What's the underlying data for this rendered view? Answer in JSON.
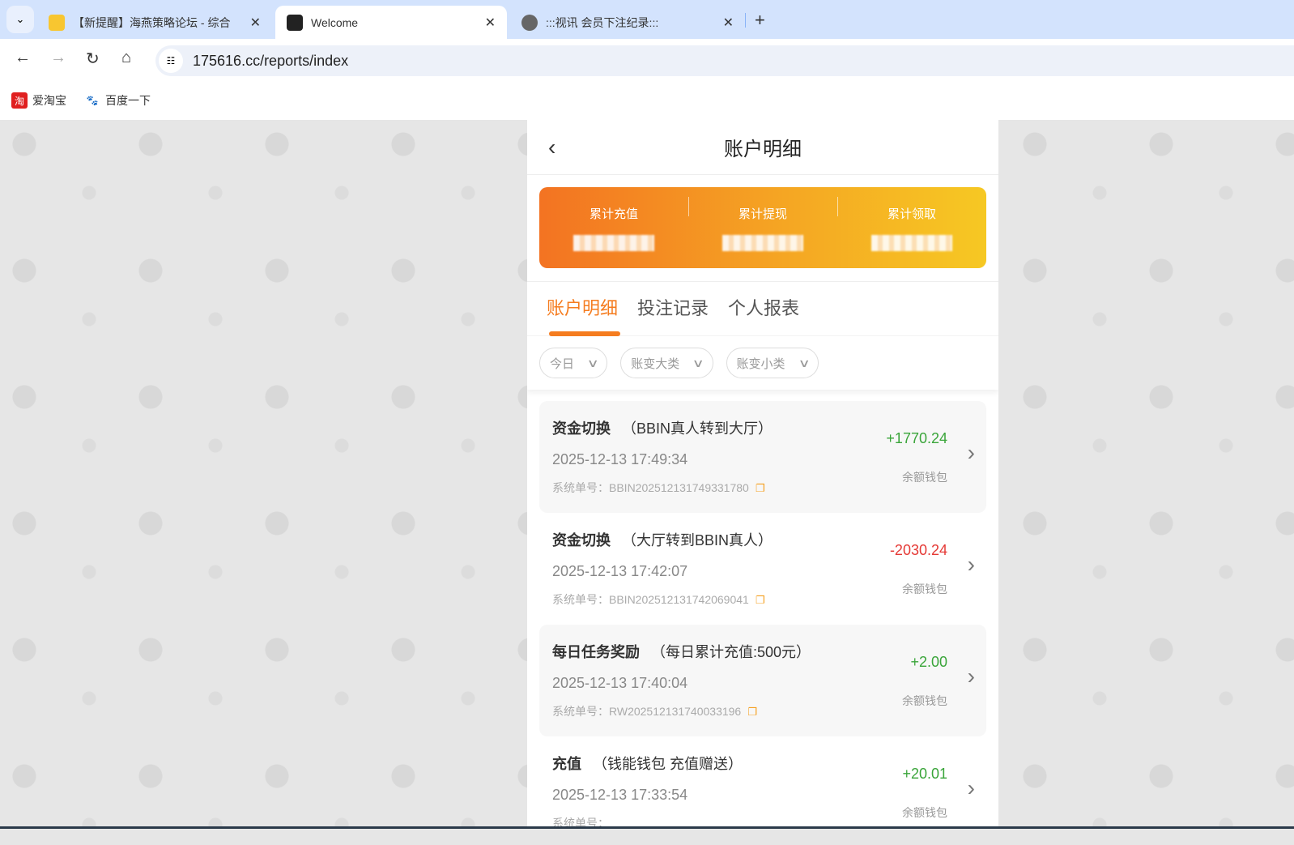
{
  "browser": {
    "tabs": [
      {
        "title": "【新提醒】海燕策略论坛 - 综合",
        "icon": "bulb-icon"
      },
      {
        "title": "Welcome",
        "icon": "site-logo-icon",
        "active": true
      },
      {
        "title": ":::视讯 会员下注纪录:::",
        "icon": "globe-icon"
      }
    ],
    "url": "175616.cc/reports/index",
    "bookmarks": [
      {
        "label": "爱淘宝",
        "icon": "淘"
      },
      {
        "label": "百度一下",
        "icon": "🐾"
      }
    ]
  },
  "page": {
    "title": "账户明细",
    "summary": [
      {
        "label": "累计充值"
      },
      {
        "label": "累计提现"
      },
      {
        "label": "累计领取"
      }
    ],
    "tabs": [
      "账户明细",
      "投注记录",
      "个人报表"
    ],
    "filters": [
      "今日",
      "账变大类",
      "账变小类"
    ],
    "accent": "#f57c1f",
    "items": [
      {
        "type": "资金切换",
        "desc": "（BBIN真人转到大厅）",
        "time": "2025-12-13 17:49:34",
        "order_label": "系统单号：",
        "order": "BBIN202512131749331780",
        "amount": "+1770.24",
        "wallet": "余额钱包"
      },
      {
        "type": "资金切换",
        "desc": "（大厅转到BBIN真人）",
        "time": "2025-12-13 17:42:07",
        "order_label": "系统单号：",
        "order": "BBIN202512131742069041",
        "amount": "-2030.24",
        "wallet": "余额钱包"
      },
      {
        "type": "每日任务奖励",
        "desc": "（每日累计充值:500元）",
        "time": "2025-12-13 17:40:04",
        "order_label": "系统单号：",
        "order": "RW202512131740033196",
        "amount": "+2.00",
        "wallet": "余额钱包"
      },
      {
        "type": "充值",
        "desc": "（钱能钱包 充值赠送）",
        "time": "2025-12-13 17:33:54",
        "order_label": "系统单号：",
        "order": "",
        "amount": "+20.01",
        "wallet": "余额钱包"
      }
    ]
  }
}
